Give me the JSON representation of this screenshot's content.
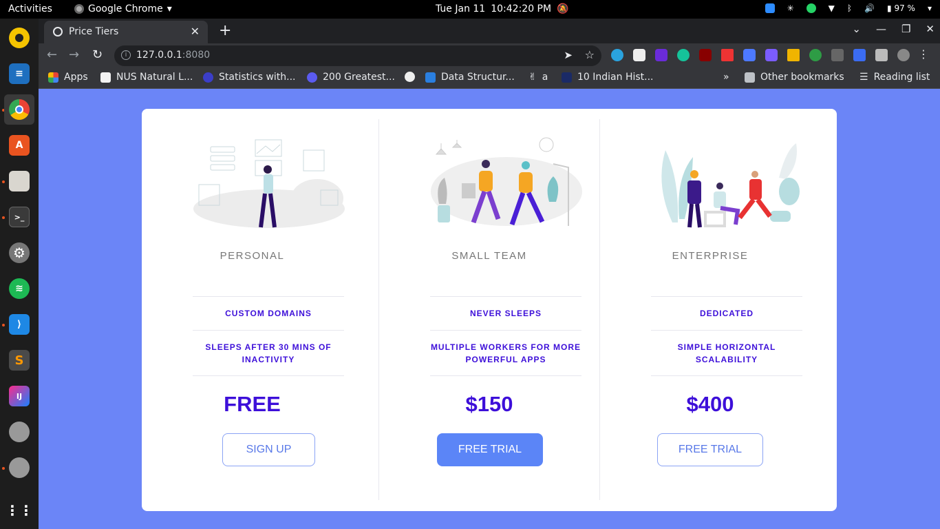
{
  "topbar": {
    "activities": "Activities",
    "app_name": "Google Chrome",
    "date": "Tue Jan 11",
    "time": "10:42:20 PM",
    "battery": "97 %"
  },
  "browser": {
    "tab_title": "Price Tiers",
    "url_host": "127.0.0.1",
    "url_port": ":8080",
    "bookmarks": [
      "Apps",
      "NUS Natural L...",
      "Statistics with...",
      "200 Greatest...",
      "",
      "Data Structur...",
      "a",
      "10 Indian Hist..."
    ],
    "other_bookmarks": "Other bookmarks",
    "reading_list": "Reading list",
    "overflow": "»"
  },
  "tiers": [
    {
      "name": "PERSONAL",
      "features": [
        "CUSTOM DOMAINS",
        "SLEEPS AFTER 30 MINS OF INACTIVITY"
      ],
      "price": "FREE",
      "cta": "SIGN UP",
      "cta_style": "outline"
    },
    {
      "name": "SMALL TEAM",
      "features": [
        "NEVER SLEEPS",
        "MULTIPLE WORKERS FOR MORE POWERFUL APPS"
      ],
      "price": "$150",
      "cta": "FREE TRIAL",
      "cta_style": "filled"
    },
    {
      "name": "ENTERPRISE",
      "features": [
        "DEDICATED",
        "SIMPLE HORIZONTAL SCALABILITY"
      ],
      "price": "$400",
      "cta": "FREE TRIAL",
      "cta_style": "outline"
    }
  ],
  "colors": {
    "page_bg": "#6b85f7",
    "accent_text": "#3d0fd9",
    "button_blue": "#5b85f7"
  }
}
